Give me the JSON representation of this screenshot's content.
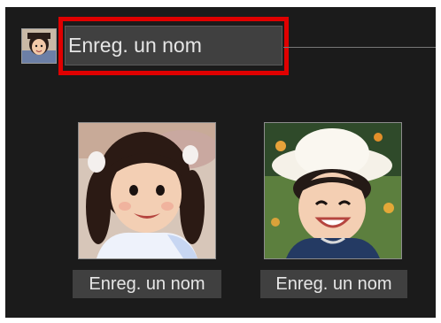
{
  "group": {
    "thumbnail_icon": "face-thumbnail",
    "name_value": "Enreg. un nom",
    "highlight_color": "#e00000"
  },
  "faces": [
    {
      "thumbnail_icon": "face-photo",
      "name_label": "Enreg. un nom"
    },
    {
      "thumbnail_icon": "face-photo",
      "name_label": "Enreg. un nom"
    }
  ]
}
